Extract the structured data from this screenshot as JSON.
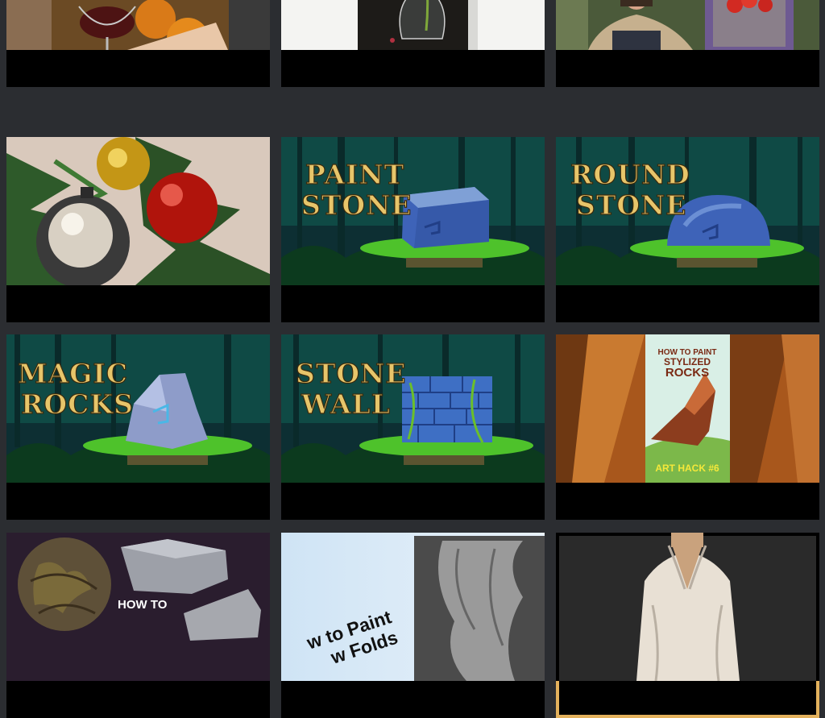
{
  "colors": {
    "background": "#2b2d31",
    "card": "#000000",
    "selected_outline": "#e3b15c",
    "title_gold": "#e7c56a",
    "forest": "#0f4a45",
    "grass": "#4ec22b"
  },
  "videos": [
    {
      "thumbnail": "still-life-wine-glass-persimmons"
    },
    {
      "thumbnail": "glass-vase-still-life"
    },
    {
      "thumbnail": "artist-with-red-flower-painting"
    },
    {
      "thumbnail": "christmas-ornaments-painting"
    },
    {
      "thumbnail": "paint-stone-title-card",
      "title_lines": [
        "PAINT",
        "STONE"
      ]
    },
    {
      "thumbnail": "round-stone-title-card",
      "title_lines": [
        "ROUND",
        "STONE"
      ]
    },
    {
      "thumbnail": "magic-rocks-title-card",
      "title_lines": [
        "MAGIC",
        "ROCKS"
      ]
    },
    {
      "thumbnail": "stone-wall-title-card",
      "title_lines": [
        "STONE",
        "WALL"
      ]
    },
    {
      "thumbnail": "stylized-rocks-art-hack",
      "book_lines": [
        "HOW TO PAINT",
        "STYLIZED",
        "ROCKS"
      ],
      "footer": "ART HACK #6"
    },
    {
      "thumbnail": "how-to-stones-textures",
      "label": "HOW TO"
    },
    {
      "thumbnail": "how-to-paint-drapery-folds",
      "title_lines": [
        "w to Paint",
        "w Folds"
      ]
    },
    {
      "thumbnail": "white-shirt-figure",
      "selected": true
    }
  ]
}
